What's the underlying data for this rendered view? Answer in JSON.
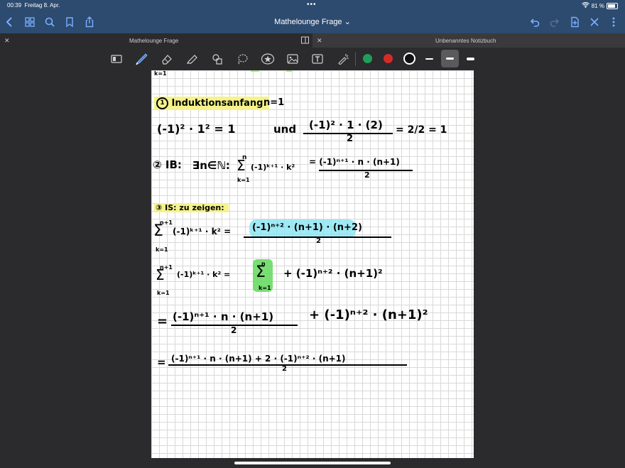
{
  "status": {
    "time": "00:39",
    "date": "Freitag 8. Apr.",
    "battery": "81 %"
  },
  "nav": {
    "title": "Mathelounge Frage ⌄"
  },
  "tabs": [
    {
      "title": "Mathelounge Frage",
      "active": true
    },
    {
      "title": "Unbenanntes Notizbuch",
      "active": false
    }
  ],
  "toolbar": {
    "colors": [
      "#1f9e5a",
      "#d62a2a",
      "#111111"
    ]
  },
  "note": {
    "top_fragment": "k=1",
    "step1_title": "Induktionsanfang:",
    "step1_cond": "n=1",
    "line1_left": "(-1)² · 1² = 1",
    "line1_und": "und",
    "line1_num": "(-1)² · 1 · (2)",
    "line1_den": "2",
    "line1_right": "= 2/2 = 1",
    "step2_title": "② IB:",
    "step2_expr": "∃n∈ℕ:",
    "step2_sum": "Σ",
    "step2_sum_top": "n",
    "step2_sum_bot": "k=1",
    "step2_term": "(-1)ᵏ⁺¹ · k²",
    "step2_num": "= (-1)ⁿ⁺¹ · n · (n+1)",
    "step2_den": "2",
    "step3_title": "③ IS: zu zeigen:",
    "l4_sum_top": "n+1",
    "l4_sum_bot": "k=1",
    "l4_term": "(-1)ᵏ⁺¹ · k² =",
    "l4_num": "(-1)ⁿ⁺² · (n+1) · (n+2)",
    "l4_den": "2",
    "l5_sum_top": "n+1",
    "l5_sum_bot": "k=1",
    "l5_term": "(-1)ᵏ⁺¹ · k² =",
    "l5_box_top": "n",
    "l5_box_bot": "k=1",
    "l5_rest": "+ (-1)ⁿ⁺² · (n+1)²",
    "l6_prefix": "=",
    "l6_num": "(-1)ⁿ⁺¹ · n · (n+1)",
    "l6_den": "2",
    "l6_rest": "+ (-1)ⁿ⁺² · (n+1)²",
    "l7_prefix": "=",
    "l7_num": "(-1)ⁿ⁺¹ · n · (n+1) + 2 · (-1)ⁿ⁺² · (n+1)",
    "l7_den": "2"
  }
}
